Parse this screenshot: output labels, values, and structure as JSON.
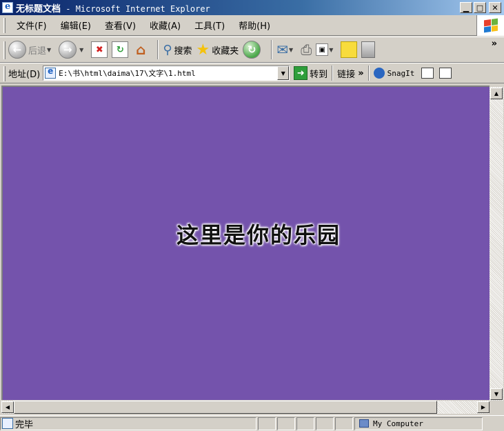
{
  "window": {
    "title_cn": "无标题文档",
    "title_sep": " - ",
    "title_app": "Microsoft Internet Explorer",
    "minimize": "▁",
    "maximize": "□",
    "close": "✕"
  },
  "menu": {
    "items": [
      "文件(F)",
      "编辑(E)",
      "查看(V)",
      "收藏(A)",
      "工具(T)",
      "帮助(H)"
    ]
  },
  "toolbar": {
    "back_label": "后退",
    "search_label": "搜索",
    "favorites_label": "收藏夹",
    "more": "»"
  },
  "address": {
    "label": "地址(D)",
    "url": "E:\\书\\html\\daima\\17\\文字\\1.html",
    "go_label": "转到",
    "links_label": "链接",
    "links_more": "»",
    "snagit_label": "SnagIt"
  },
  "content": {
    "heading": "这里是你的乐园",
    "background": "#7453ac"
  },
  "status": {
    "text": "完毕",
    "zone": "My Computer"
  }
}
